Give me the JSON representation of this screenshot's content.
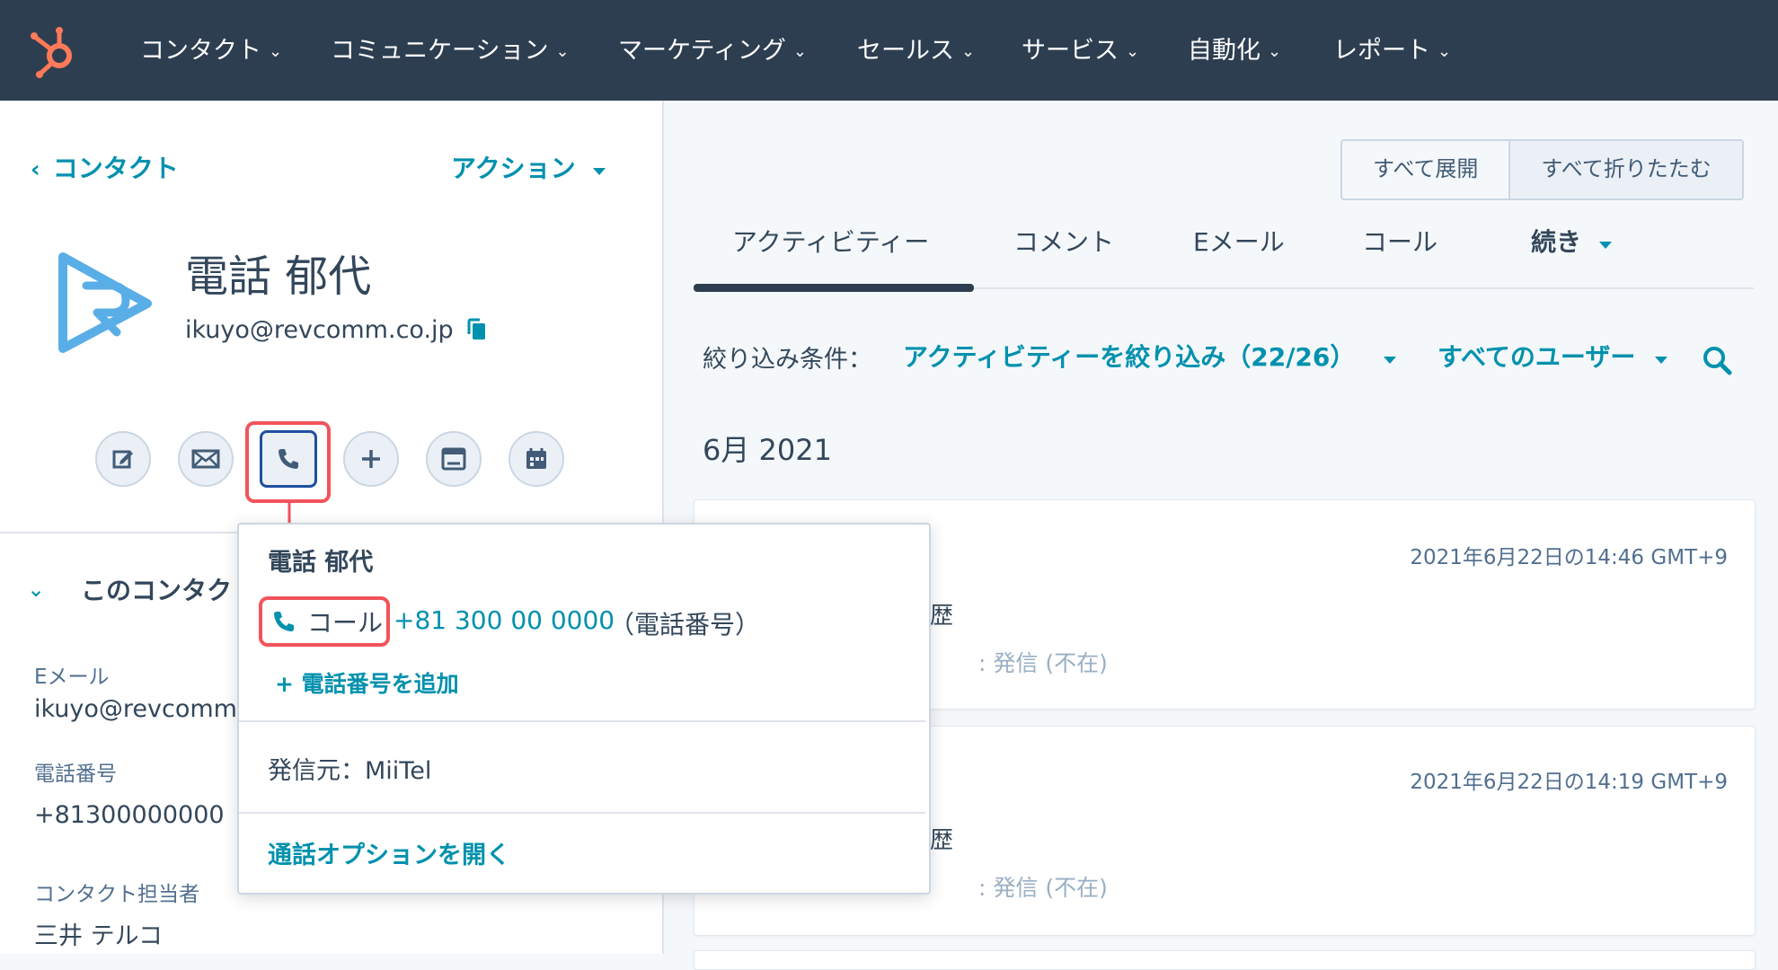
{
  "topnav": {
    "items": [
      {
        "label": "コンタクト"
      },
      {
        "label": "コミュニケーション"
      },
      {
        "label": "マーケティング"
      },
      {
        "label": "セールス"
      },
      {
        "label": "サービス"
      },
      {
        "label": "自動化"
      },
      {
        "label": "レポート"
      }
    ],
    "chevron": "⌄"
  },
  "left": {
    "back_link": "コンタクト",
    "back_arrow": "‹",
    "actions_label": "アクション",
    "contact_name": "電話 郁代",
    "contact_email": "ikuyo@revcomm.co.jp",
    "section_title": "このコンタク",
    "fields": [
      {
        "label": "Eメール",
        "value": "ikuyo@revcomm."
      },
      {
        "label": "電話番号",
        "value": "+81300000000"
      },
      {
        "label": "コンタクト担当者",
        "value": "三井 テルコ"
      }
    ]
  },
  "right": {
    "expand_all": "すべて展開",
    "collapse_all": "すべて折りたたむ",
    "tabs": [
      {
        "label": "アクティビティー"
      },
      {
        "label": "コメント"
      },
      {
        "label": "Eメール"
      },
      {
        "label": "コール"
      },
      {
        "label": "続き"
      }
    ],
    "filter_label": "絞り込み条件：",
    "filter_activity": "アクティビティーを絞り込み（22/26）",
    "filter_users": "すべてのユーザー",
    "month_header": "6月 2021",
    "cards": [
      {
        "timestamp": "2021年6月22日の14:46 GMT+9",
        "frag": "歴",
        "status": ": 発信 (不在)"
      },
      {
        "timestamp": "2021年6月22日の14:19 GMT+9",
        "frag": "歴",
        "status": ": 発信 (不在)"
      }
    ]
  },
  "dropdown": {
    "name": "電話 郁代",
    "call_label": "コール",
    "phone_number": "+81 300 00 0000",
    "phone_type": "（電話番号）",
    "add_phone": "+ 電話番号を追加",
    "caller": "発信元：MiiTel",
    "open_options": "通話オプションを開く"
  },
  "colors": {
    "nav_bg": "#2d3e50",
    "accent": "#0091ae",
    "highlight": "#f2545b",
    "logo": "#ff7a59"
  }
}
